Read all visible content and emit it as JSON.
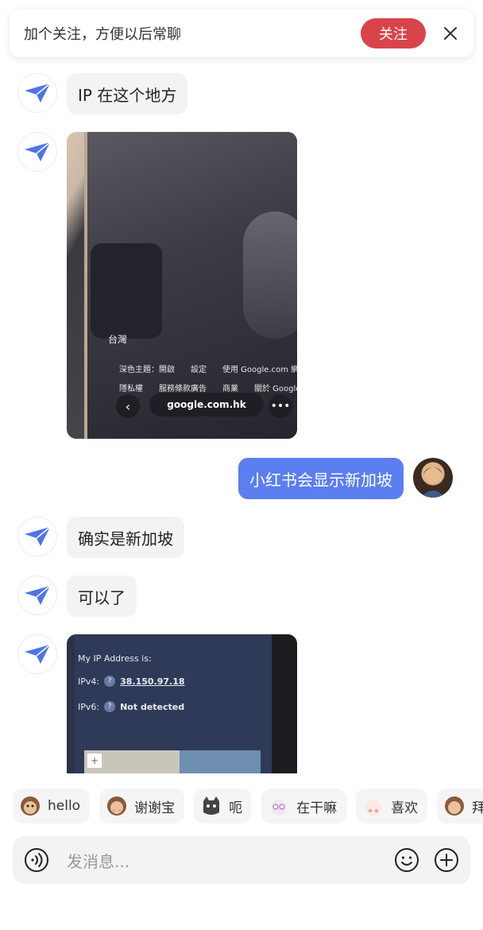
{
  "follow_banner": {
    "text": "加个关注，方便以后常聊",
    "follow_label": "关注",
    "accent": "#d9444b"
  },
  "messages": [
    {
      "side": "in",
      "type": "text",
      "text": "IP 在这个地方",
      "avatar_icon": "paper-plane-icon"
    },
    {
      "side": "in",
      "type": "image",
      "avatar_icon": "paper-plane-icon",
      "image": {
        "region_label": "台灣",
        "footer_line1": "深色主題：開啟　　設定　　使用 Google.com 網域",
        "footer_line2": "隱私權　　服務條款廣告　　商業　　關於 Google",
        "url": "google.com.hk"
      }
    },
    {
      "side": "out",
      "type": "text",
      "text": "小红书会显示新加坡"
    },
    {
      "side": "in",
      "type": "text",
      "text": "确实是新加坡",
      "avatar_icon": "paper-plane-icon"
    },
    {
      "side": "in",
      "type": "text",
      "text": "可以了",
      "avatar_icon": "paper-plane-icon"
    },
    {
      "side": "in",
      "type": "image",
      "avatar_icon": "paper-plane-icon",
      "image": {
        "heading": "My IP Address is:",
        "ipv4_label": "IPv4:",
        "ipv4_value": "38.150.97.18",
        "ipv6_label": "IPv6:",
        "ipv6_value": "Not detected",
        "zoom_symbol": "+"
      }
    }
  ],
  "quick_replies": [
    {
      "label": "hello",
      "icon": "monkey-icon"
    },
    {
      "label": "谢谢宝",
      "icon": "monkey-thanks-icon"
    },
    {
      "label": "呃",
      "icon": "cat-icon"
    },
    {
      "label": "在干嘛",
      "icon": "rabbit-icon"
    },
    {
      "label": "喜欢",
      "icon": "rabbit-love-icon"
    },
    {
      "label": "拜",
      "icon": "monkey-bye-icon"
    }
  ],
  "input_bar": {
    "placeholder": "发消息..."
  },
  "colors": {
    "outgoing_bubble": "#5b7ff0",
    "incoming_bubble": "#f3f3f3",
    "avatar_plane": "#4f74e8"
  }
}
